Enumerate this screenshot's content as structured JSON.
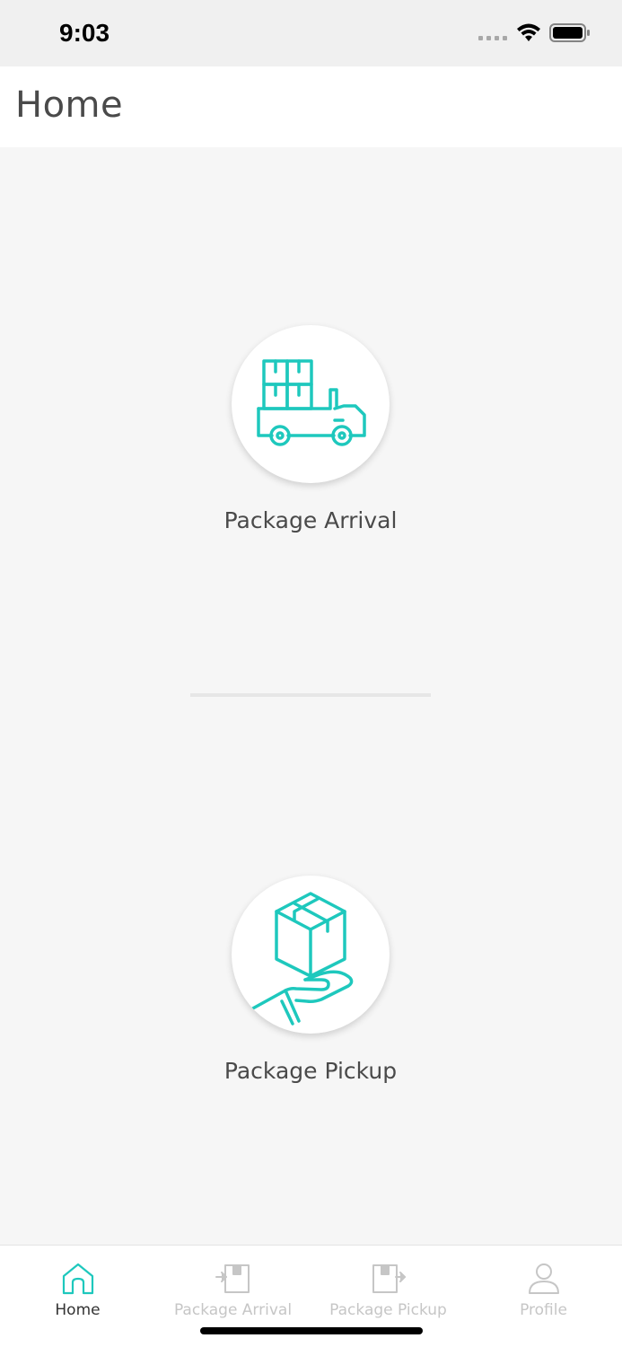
{
  "status_bar": {
    "time": "9:03"
  },
  "header": {
    "title": "Home"
  },
  "actions": [
    {
      "id": "arrival",
      "label": "Package Arrival",
      "icon": "delivery-truck-icon"
    },
    {
      "id": "pickup",
      "label": "Package Pickup",
      "icon": "package-in-hand-icon"
    }
  ],
  "tab_bar": {
    "items": [
      {
        "label": "Home",
        "icon": "home-icon",
        "active": true
      },
      {
        "label": "Package Arrival",
        "icon": "package-arrival-icon",
        "active": false
      },
      {
        "label": "Package Pickup",
        "icon": "package-pickup-icon",
        "active": false
      },
      {
        "label": "Profile",
        "icon": "profile-icon",
        "active": false
      }
    ]
  },
  "colors": {
    "accent": "#1ec8bd",
    "text": "#4a4a4a",
    "background": "#f6f6f6",
    "inactive_tab": "#c6c6c6"
  }
}
